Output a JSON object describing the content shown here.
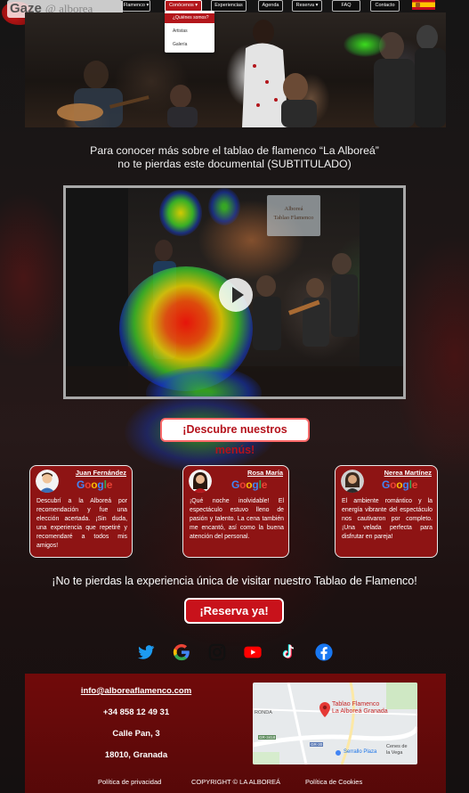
{
  "watermark": {
    "brand": "Gaze",
    "rest": "@ alborea"
  },
  "nav": {
    "items": [
      {
        "label": "Flamenco"
      },
      {
        "label": "Conócenos"
      },
      {
        "label": "Experiencias"
      },
      {
        "label": "Agenda"
      },
      {
        "label": "Reserva"
      },
      {
        "label": "FAQ"
      },
      {
        "label": "Contacto"
      }
    ],
    "dropdown": [
      "¿Quiénes somos?",
      "Artistas",
      "Galería"
    ],
    "language_flag": "spain-flag-icon"
  },
  "intro": {
    "line1": "Para conocer más sobre el tablao de flamenco “La Alboreá”",
    "line2": "no te pierdas este documental (SUBTITULADO)"
  },
  "video": {
    "sign_line1": "Alboreá",
    "sign_line2": "Tablao Flamenco"
  },
  "menus_button": "¡Descubre nuestros menús!",
  "reviews": [
    {
      "name": "Juan Fernández",
      "source": "Google",
      "text": "Descubrí a la Alboreá por recomendación y fue una elección acertada. ¡Sin duda, una experiencia que repetiré y recomendaré a todos mis amigos!"
    },
    {
      "name": "Rosa María",
      "source": "Google",
      "text": "¡Qué noche inolvidable! El espectáculo estuvo lleno de pasión y talento. La cena también me encantó, así como la buena atención del personal."
    },
    {
      "name": "Nerea Martínez",
      "source": "Google",
      "text": "El ambiente romántico y la energía vibrante del espectáculo nos cautivaron por completo. ¡Una velada perfecta para disfrutar en pareja!"
    }
  ],
  "cta_text": "¡No te pierdas la experiencia única de visitar nuestro Tablao de Flamenco!",
  "reserve_button": "¡Reserva ya!",
  "social": [
    "twitter-icon",
    "google-icon",
    "instagram-icon",
    "youtube-icon",
    "tiktok-icon",
    "facebook-icon"
  ],
  "footer": {
    "email": "info@alboreaflamenco.com",
    "phone": "+34 858 12 49 31",
    "street": "Calle Pan, 3",
    "city": "18010, Granada",
    "map": {
      "place": "Tablao Flamenco",
      "place2": "La Alboreá Granada",
      "area1": "RONDA",
      "area2": "Serrallo Plaza",
      "area3": "Cenes de",
      "area4": "la Vega",
      "road1": "GR-3418",
      "road2": "GR-30"
    },
    "links": [
      "Política de privacidad",
      "COPYRIGHT © LA ALBOREÁ",
      "Política de Cookies"
    ]
  },
  "colors": {
    "brand_red": "#b3161b",
    "review_bg": "#8e1414",
    "footer_bg": "#7a0a0a"
  }
}
